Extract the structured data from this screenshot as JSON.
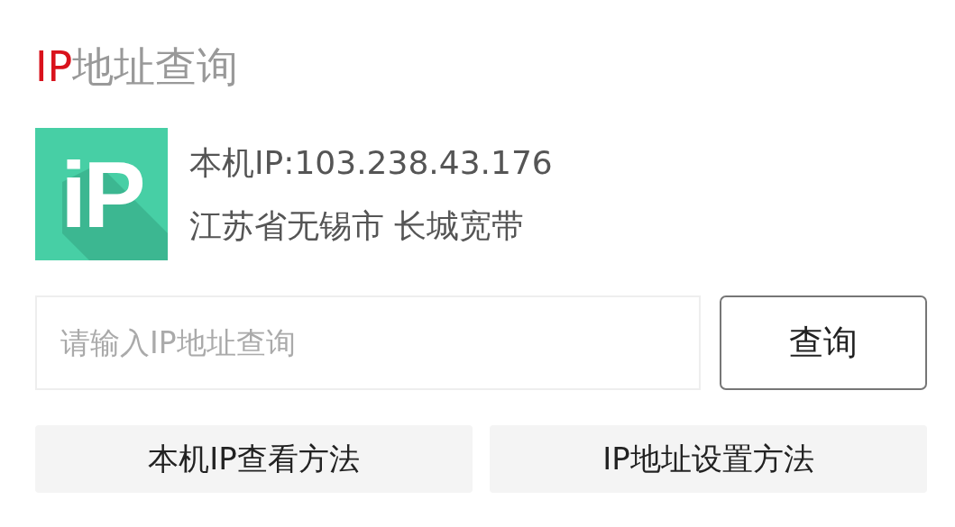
{
  "title": {
    "accent": "IP",
    "text": "地址查询"
  },
  "logo": {
    "text": "iP"
  },
  "info": {
    "ip": "本机IP:103.238.43.176",
    "location": "江苏省无锡市 长城宽带"
  },
  "search": {
    "placeholder": "请输入IP地址查询",
    "button": "查询"
  },
  "links": [
    "本机IP查看方法",
    "IP地址设置方法"
  ]
}
